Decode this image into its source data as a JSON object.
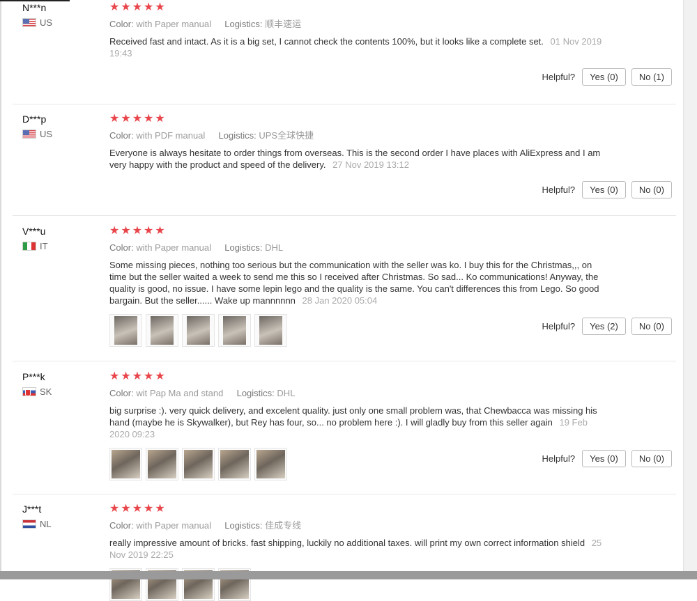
{
  "reviews": [
    {
      "user": "N***n",
      "country": "US",
      "flag": "us",
      "stars": [
        "★",
        "★",
        "★",
        "★",
        "★"
      ],
      "rating": 5,
      "color_label": "Color:",
      "color_value": "with Paper manual",
      "logistics_label": "Logistics:",
      "logistics_value": "顺丰速运",
      "text": "Received fast and intact. As it is a big set, I cannot check the contents 100%, but it looks like a complete set.",
      "date": "01 Nov 2019 19:43",
      "helpful_label": "Helpful?",
      "yes_label": "Yes (0)",
      "no_label": "No (1)"
    },
    {
      "user": "D***p",
      "country": "US",
      "flag": "us",
      "stars": [
        "★",
        "★",
        "★",
        "★",
        "★"
      ],
      "rating": 5,
      "color_label": "Color:",
      "color_value": "with PDF manual",
      "logistics_label": "Logistics:",
      "logistics_value": "UPS全球快捷",
      "text": "Everyone is always hesitate to order things from overseas. This is the second order I have places with AliExpress and I am very happy with the product and speed of the delivery.",
      "date": "27 Nov 2019 13:12",
      "helpful_label": "Helpful?",
      "yes_label": "Yes (0)",
      "no_label": "No (0)"
    },
    {
      "user": "V***u",
      "country": "IT",
      "flag": "it",
      "stars": [
        "★",
        "★",
        "★",
        "★",
        "★"
      ],
      "rating": 5,
      "color_label": "Color:",
      "color_value": "with Paper manual",
      "logistics_label": "Logistics:",
      "logistics_value": "DHL",
      "text": "Some missing pieces, nothing too serious but the communication with the seller was ko. I buy this for the Christmas,,, on time but the seller waited a week to send me this so I received after Christmas. So sad... Ko communications! Anyway, the quality is good, no issue. I have some lepin lego and the quality is the same. You can't differences this from Lego. So good bargain. But the seller...... Wake up mannnnnn",
      "date": "28 Jan 2020 05:04",
      "helpful_label": "Helpful?",
      "yes_label": "Yes (2)",
      "no_label": "No (0)"
    },
    {
      "user": "P***k",
      "country": "SK",
      "flag": "sk",
      "stars": [
        "★",
        "★",
        "★",
        "★",
        "★"
      ],
      "rating": 5,
      "color_label": "Color:",
      "color_value": "wit Pap Ma and stand",
      "logistics_label": "Logistics:",
      "logistics_value": "DHL",
      "text": "big surprise :). very quick delivery, and excelent quality. just only one small problem was, that Chewbacca was missing his hand (maybe he is Skywalker), but Rey has four, so... no problem here :). I will gladly buy from this seller again",
      "date": "19 Feb 2020 09:23",
      "helpful_label": "Helpful?",
      "yes_label": "Yes (0)",
      "no_label": "No (0)"
    },
    {
      "user": "J***t",
      "country": "NL",
      "flag": "nl",
      "stars": [
        "★",
        "★",
        "★",
        "★",
        "★"
      ],
      "rating": 5,
      "color_label": "Color:",
      "color_value": "with Paper manual",
      "logistics_label": "Logistics:",
      "logistics_value": "佳成专线",
      "text": "really impressive amount of bricks. fast shipping, luckily no additional taxes. will print my own correct information shield",
      "date": "25 Nov 2019 22:25"
    }
  ]
}
